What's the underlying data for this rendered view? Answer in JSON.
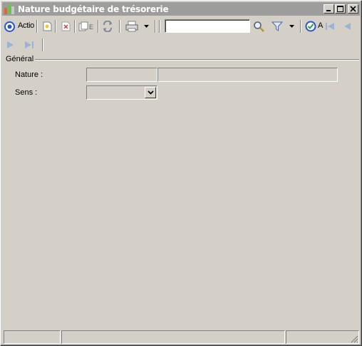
{
  "window": {
    "title": "Nature budgétaire de trésorerie",
    "titlebar_color": "#9d9d9d"
  },
  "toolbar": {
    "action_label": "Actio",
    "search": {
      "value": "",
      "placeholder": ""
    },
    "suffix_label": "A",
    "icons": [
      "action-icon",
      "new-icon",
      "delete-icon",
      "duplicate-icon",
      "refresh-icon",
      "print-icon",
      "dropdown-arrow-icon",
      "search-icon",
      "filter-icon",
      "dropdown-arrow-icon",
      "apply-icon",
      "first-record-icon",
      "previous-record-icon",
      "next-record-icon",
      "last-record-icon"
    ]
  },
  "form": {
    "group_title": "Général",
    "fields": {
      "nature": {
        "label": "Nature :",
        "code": "",
        "description": ""
      },
      "sens": {
        "label": "Sens :",
        "value": ""
      }
    }
  },
  "statusbar": {
    "panels": [
      "",
      "",
      ""
    ]
  }
}
